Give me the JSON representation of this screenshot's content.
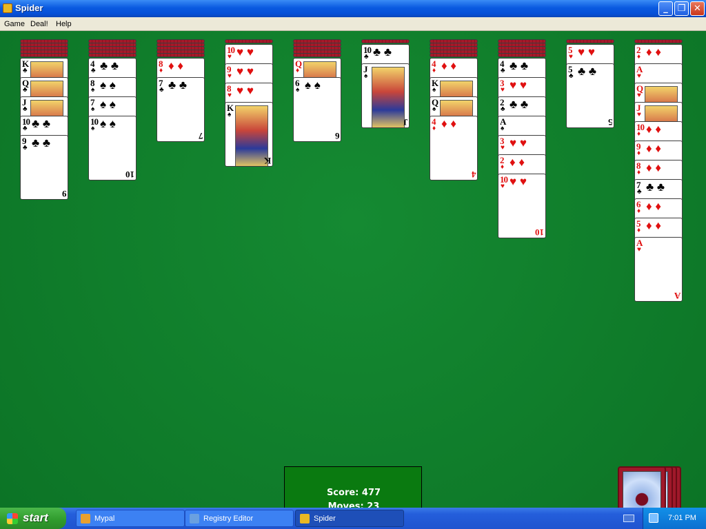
{
  "window": {
    "title": "Spider"
  },
  "menu": [
    "Game",
    "Deal!",
    "Help"
  ],
  "tableau": [
    {
      "backs": 5,
      "cards": [
        [
          "K",
          "♣",
          "blk"
        ],
        [
          "Q",
          "♣",
          "blk"
        ],
        [
          "J",
          "♣",
          "blk"
        ],
        [
          "10",
          "♣",
          "blk"
        ],
        [
          "9",
          "♣",
          "blk"
        ]
      ]
    },
    {
      "backs": 5,
      "cards": [
        [
          "4",
          "♣",
          "blk"
        ],
        [
          "8",
          "♠",
          "blk"
        ],
        [
          "7",
          "♠",
          "blk"
        ],
        [
          "10",
          "♠",
          "blk"
        ]
      ]
    },
    {
      "backs": 5,
      "cards": [
        [
          "8",
          "♦",
          "red"
        ],
        [
          "7",
          "♣",
          "blk"
        ]
      ]
    },
    {
      "backs": 1,
      "cards": [
        [
          "10",
          "♥",
          "red"
        ],
        [
          "9",
          "♥",
          "red"
        ],
        [
          "8",
          "♥",
          "red"
        ],
        [
          "K",
          "♠",
          "blk"
        ]
      ]
    },
    {
      "backs": 5,
      "cards": [
        [
          "Q",
          "♦",
          "red"
        ],
        [
          "6",
          "♠",
          "blk"
        ]
      ]
    },
    {
      "backs": 1,
      "cards": [
        [
          "10",
          "♣",
          "blk"
        ],
        [
          "J",
          "♠",
          "blk"
        ]
      ]
    },
    {
      "backs": 5,
      "cards": [
        [
          "4",
          "♦",
          "red"
        ],
        [
          "K",
          "♠",
          "blk"
        ],
        [
          "Q",
          "♠",
          "blk"
        ],
        [
          "4",
          "♦",
          "red"
        ]
      ]
    },
    {
      "backs": 5,
      "cards": [
        [
          "4",
          "♣",
          "blk"
        ],
        [
          "3",
          "♥",
          "red"
        ],
        [
          "2",
          "♣",
          "blk"
        ],
        [
          "A",
          "♠",
          "blk"
        ],
        [
          "3",
          "♥",
          "red"
        ],
        [
          "2",
          "♦",
          "red"
        ],
        [
          "10",
          "♥",
          "red"
        ]
      ]
    },
    {
      "backs": 1,
      "cards": [
        [
          "5",
          "♥",
          "red"
        ],
        [
          "5",
          "♣",
          "blk"
        ]
      ]
    },
    {
      "backs": 1,
      "cards": [
        [
          "2",
          "♦",
          "red"
        ],
        [
          "A",
          "♥",
          "red"
        ],
        [
          "Q",
          "♥",
          "red"
        ],
        [
          "J",
          "♥",
          "red"
        ],
        [
          "10",
          "♦",
          "red"
        ],
        [
          "9",
          "♦",
          "red"
        ],
        [
          "8",
          "♦",
          "red"
        ],
        [
          "7",
          "♣",
          "blk"
        ],
        [
          "6",
          "♦",
          "red"
        ],
        [
          "5",
          "♦",
          "red"
        ],
        [
          "A",
          "♥",
          "red"
        ]
      ]
    }
  ],
  "status": {
    "score_label": "Score:",
    "score": "477",
    "moves_label": "Moves:",
    "moves": "23"
  },
  "taskbar": {
    "start": "start",
    "tasks": [
      "Mypal",
      "Registry Editor",
      "Spider"
    ],
    "clock": "7:01 PM"
  },
  "colors": {
    "felt": "#0f7a2a",
    "card_back": "#a41a2a",
    "red_suit": "#e01010"
  }
}
